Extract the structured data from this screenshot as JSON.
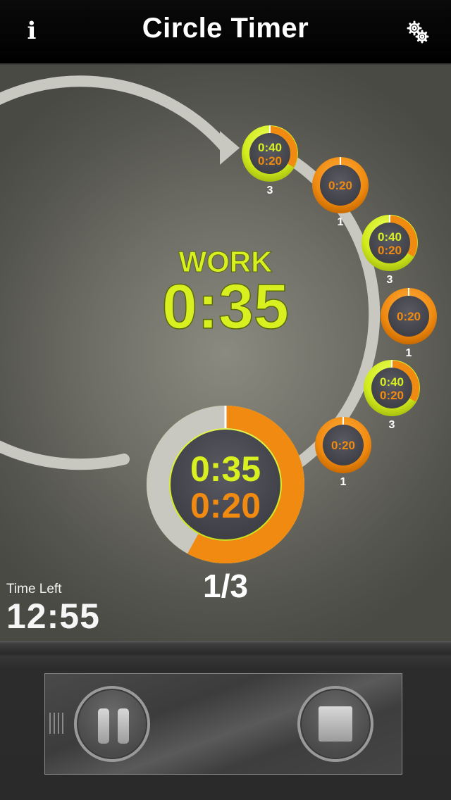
{
  "header": {
    "title": "Circle Timer",
    "info_icon": "info-icon",
    "settings_icon": "gears-icon"
  },
  "current": {
    "phase_label": "WORK",
    "phase_time": "0:35",
    "big_time_top": "0:35",
    "big_time_bottom": "0:20",
    "counter": "1/3",
    "work_progress": 0.58
  },
  "stations": [
    {
      "top": "0:40",
      "bottom": "0:20",
      "count": "3",
      "kind": "work"
    },
    {
      "top": "0:20",
      "bottom": "",
      "count": "1",
      "kind": "rest"
    },
    {
      "top": "0:40",
      "bottom": "0:20",
      "count": "3",
      "kind": "work"
    },
    {
      "top": "0:20",
      "bottom": "",
      "count": "1",
      "kind": "rest"
    },
    {
      "top": "0:40",
      "bottom": "0:20",
      "count": "3",
      "kind": "work"
    },
    {
      "top": "0:20",
      "bottom": "",
      "count": "1",
      "kind": "rest"
    }
  ],
  "time_left": {
    "label": "Time Left",
    "value": "12:55"
  },
  "controls": {
    "pause_icon": "pause-icon",
    "stop_icon": "stop-icon",
    "grip_icon": "grip-icon"
  },
  "colors": {
    "work": "#d8f020",
    "rest": "#f08a10",
    "track": "#c8c8c0",
    "inner": "#4a4a52"
  }
}
